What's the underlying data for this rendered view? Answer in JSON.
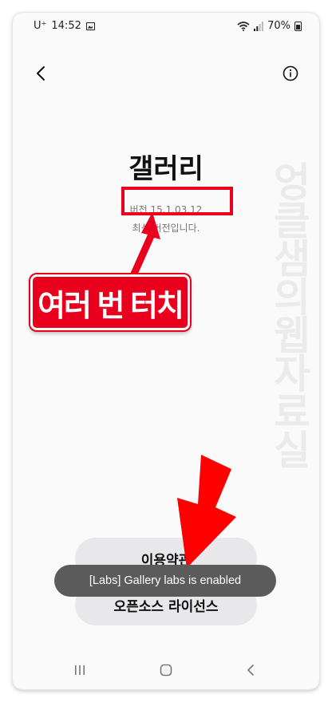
{
  "status_bar": {
    "carrier": "U⁺",
    "time": "14:52",
    "battery": "70%"
  },
  "header": {
    "back_icon": "chevron-left-icon",
    "info_icon": "info-circle-icon"
  },
  "app": {
    "title": "갤러리",
    "version": "버전 15.1.03.12",
    "status": "최신 버전입니다."
  },
  "annotation": {
    "label": "여러 번 터치",
    "color": "#e8001c"
  },
  "watermark": "엉클샘의웹자료실",
  "buttons": {
    "terms": "이용약관",
    "open_source": "오픈소스 라이선스"
  },
  "toast": {
    "message": "[Labs] Gallery labs is enabled"
  },
  "nav": {
    "recents_icon": "recents-icon",
    "home_icon": "home-icon",
    "back_icon": "back-icon"
  }
}
